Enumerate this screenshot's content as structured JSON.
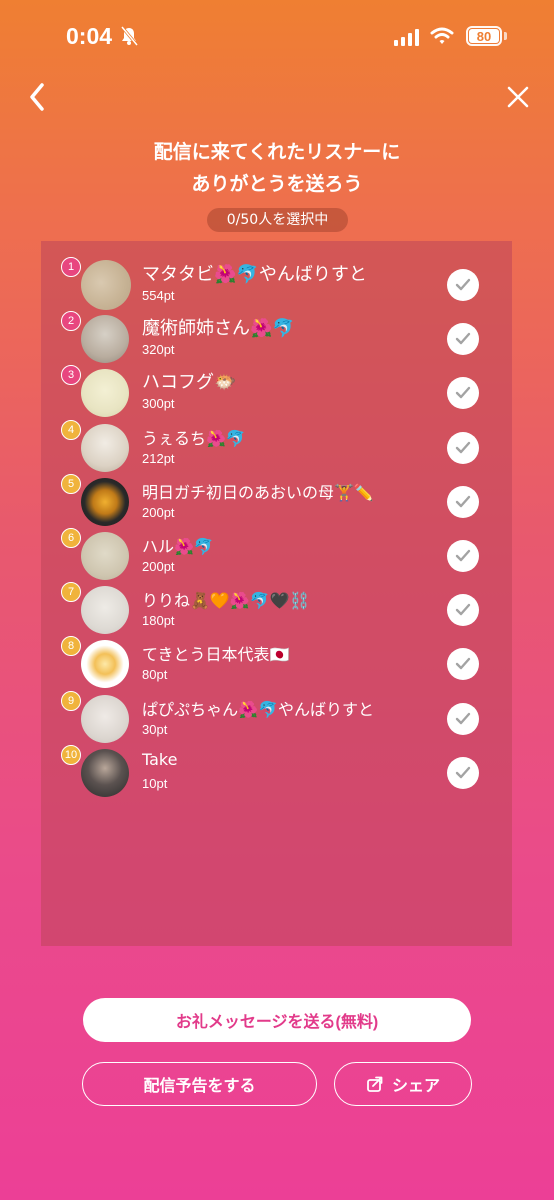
{
  "status_bar": {
    "time": "0:04",
    "battery": "80"
  },
  "header": {
    "title_line1": "配信に来てくれたリスナーに",
    "title_line2": "ありがとうを送ろう",
    "counter": "0/50人を選択中"
  },
  "listeners": [
    {
      "rank": "1",
      "name": "マタタビ🌺🐬やんばりすと",
      "points": "554pt"
    },
    {
      "rank": "2",
      "name": "魔術師姉さん🌺🐬",
      "points": "320pt"
    },
    {
      "rank": "3",
      "name": "ハコフグ🐡",
      "points": "300pt"
    },
    {
      "rank": "4",
      "name": "うぇるち🌺🐬",
      "points": "212pt"
    },
    {
      "rank": "5",
      "name": "明日ガチ初日のあおいの母🏋️✏️",
      "points": "200pt"
    },
    {
      "rank": "6",
      "name": "ハル🌺🐬",
      "points": "200pt"
    },
    {
      "rank": "7",
      "name": "りりね🧸🧡🌺🐬🖤⛓️",
      "points": "180pt"
    },
    {
      "rank": "8",
      "name": "てきとう日本代表🇯🇵",
      "points": "80pt"
    },
    {
      "rank": "9",
      "name": "ぱぴぷちゃん🌺🐬やんばりすと",
      "points": "30pt"
    },
    {
      "rank": "10",
      "name": "Take",
      "points": "10pt"
    }
  ],
  "rank_colors": {
    "1": "#e8467f",
    "2": "#e8467f",
    "3": "#e8467f",
    "4": "#f0b33c",
    "5": "#f0b33c",
    "6": "#f0b33c",
    "7": "#f0b33c",
    "8": "#f0b33c",
    "9": "#f0b33c",
    "10": "#f0b33c"
  },
  "actions": {
    "send_message": "お礼メッセージを送る(無料)",
    "announce": "配信予告をする",
    "share": "シェア"
  },
  "colors": {
    "accent": "#e23a8a"
  }
}
